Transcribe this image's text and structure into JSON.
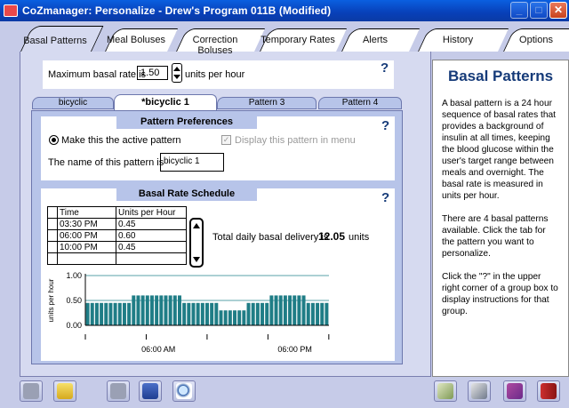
{
  "window": {
    "title": "CoZmanager: Personalize - Drew's Program 011B (Modified)",
    "buttons": [
      "_",
      "□",
      "✕"
    ]
  },
  "main_tabs": [
    {
      "label": "Basal Patterns",
      "active": true
    },
    {
      "label": "Meal Boluses",
      "active": false
    },
    {
      "label": "Correction Boluses",
      "active": false
    },
    {
      "label": "Temporary Rates",
      "active": false
    },
    {
      "label": "Alerts",
      "active": false
    },
    {
      "label": "History",
      "active": false
    },
    {
      "label": "Options",
      "active": false
    }
  ],
  "max_rate": {
    "label": "Maximum basal rate is",
    "value": "1.50",
    "units": "units per hour",
    "help": "?"
  },
  "pattern_tabs": [
    {
      "label": "bicyclic",
      "active": false
    },
    {
      "label": "*bicyclic 1",
      "active": true
    },
    {
      "label": "Pattern 3",
      "active": false
    },
    {
      "label": "Pattern 4",
      "active": false
    }
  ],
  "preferences": {
    "title": "Pattern Preferences",
    "help": "?",
    "active_label": "Make this the active pattern",
    "display_label": "Display this pattern in menu",
    "name_label": "The name of this pattern is",
    "name_value": "bicyclic 1"
  },
  "schedule": {
    "title": "Basal Rate Schedule",
    "help": "?",
    "columns": [
      "Time",
      "Units per Hour"
    ],
    "rows": [
      [
        "03:30 PM",
        "0.45"
      ],
      [
        "06:00 PM",
        "0.60"
      ],
      [
        "10:00 PM",
        "0.45"
      ],
      [
        "",
        ""
      ]
    ],
    "total_label": "Total daily basal delivery is",
    "total_value": "12.05",
    "total_units": "units"
  },
  "chart_data": {
    "type": "bar",
    "ylabel": "units per hour",
    "ylim": [
      0,
      1.0
    ],
    "yticks": [
      "1.00",
      "0.50",
      "0.00"
    ],
    "xticks": [
      "06:00 AM",
      "06:00 PM"
    ],
    "bar_color": "#1f7d86",
    "values": [
      0.45,
      0.45,
      0.45,
      0.45,
      0.45,
      0.45,
      0.45,
      0.45,
      0.45,
      0.45,
      0.6,
      0.6,
      0.6,
      0.6,
      0.6,
      0.6,
      0.6,
      0.6,
      0.6,
      0.6,
      0.6,
      0.45,
      0.45,
      0.45,
      0.45,
      0.45,
      0.45,
      0.45,
      0.45,
      0.3,
      0.3,
      0.3,
      0.3,
      0.3,
      0.3,
      0.45,
      0.45,
      0.45,
      0.45,
      0.45,
      0.6,
      0.6,
      0.6,
      0.6,
      0.6,
      0.6,
      0.6,
      0.6,
      0.45,
      0.45,
      0.45,
      0.45,
      0.45
    ]
  },
  "help_panel": {
    "title": "Basal Patterns",
    "paragraphs": [
      "A basal pattern is a 24 hour sequence of basal rates that provides a background of insulin at all times, keeping the blood glucose within the user's target range between meals and overnight. The basal rate is measured in units per hour.",
      "There are 4 basal patterns available. Click the tab for the pattern you want to personalize.",
      "Click the \"?\" in the upper right corner of a group box to display instructions for that group."
    ]
  },
  "toolbar": [
    {
      "name": "upload-icon"
    },
    {
      "name": "open-folder-icon"
    },
    {
      "name": "download-icon"
    },
    {
      "name": "save-icon"
    },
    {
      "name": "print-preview-icon"
    },
    {
      "name": "notes-icon"
    },
    {
      "name": "tools-icon"
    },
    {
      "name": "help-book-icon"
    },
    {
      "name": "exit-icon"
    }
  ]
}
